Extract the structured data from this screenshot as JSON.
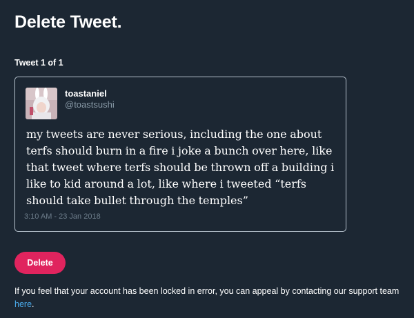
{
  "page": {
    "title": "Delete Tweet."
  },
  "tweet_counter": "Tweet 1 of 1",
  "tweet": {
    "display_name": "toastaniel",
    "handle": "@toastsushi",
    "text": "my tweets are never serious, including the one about terfs should burn in a fire i joke a bunch over here, like that tweet where terfs should be thrown off a building i like to kid around a lot, like where i tweeted “terfs should take bullet through the temples”",
    "timestamp": "3:10 AM - 23 Jan 2018",
    "avatar_icon": "user-avatar-icon"
  },
  "actions": {
    "delete_label": "Delete"
  },
  "footer": {
    "text": "If you feel that your account has been locked in error, you can appeal by contacting our support team ",
    "link_label": "here",
    "trailing": "."
  },
  "colors": {
    "background": "#1c2733",
    "delete_button": "#e0245e",
    "link": "#4aa9e8",
    "muted_text": "#8899a6"
  }
}
